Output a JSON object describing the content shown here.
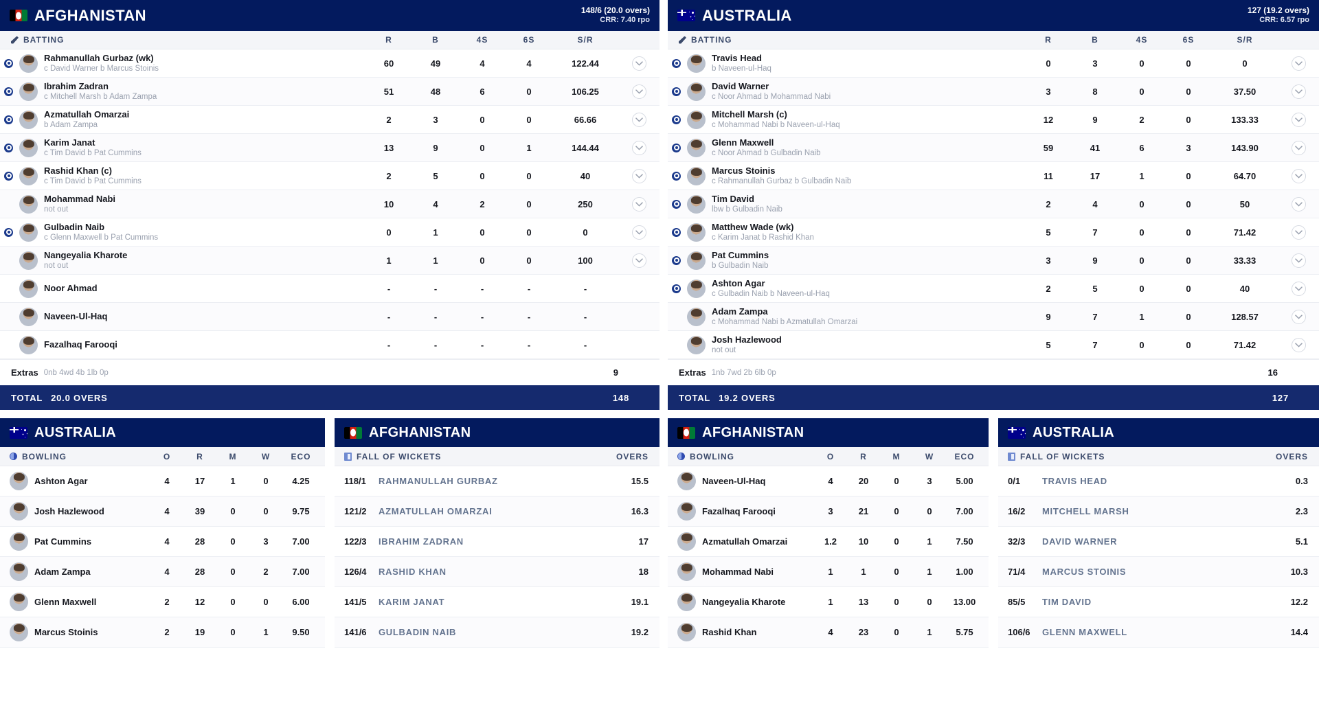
{
  "icons": {
    "bat": "bat-icon",
    "ball": "ball-icon",
    "pad": "pad-icon",
    "chevron": "chevron-down-icon"
  },
  "colors": {
    "header_navy": "#031a5e",
    "total_navy": "#152a6e",
    "col_head_bg": "#f4f5f8",
    "muted_text": "#9aa1af",
    "fow_name": "#64748f"
  },
  "innings": [
    {
      "id": "afghanistan-innings",
      "team": "AFGHANISTAN",
      "flag": "afghanistan-flag",
      "score": "148/6 (20.0 overs)",
      "crr": "CRR: 7.40 rpo",
      "section_label": "BATTING",
      "columns": [
        "R",
        "B",
        "4S",
        "6S",
        "S/R"
      ],
      "batters": [
        {
          "name": "Rahmanullah Gurbaz (wk)",
          "dismissal": "c David Warner b Marcus Stoinis",
          "r": "60",
          "b": "49",
          "fours": "4",
          "sixes": "4",
          "sr": "122.44",
          "out": true
        },
        {
          "name": "Ibrahim Zadran",
          "dismissal": "c Mitchell Marsh b Adam Zampa",
          "r": "51",
          "b": "48",
          "fours": "6",
          "sixes": "0",
          "sr": "106.25",
          "out": true
        },
        {
          "name": "Azmatullah Omarzai",
          "dismissal": "b Adam Zampa",
          "r": "2",
          "b": "3",
          "fours": "0",
          "sixes": "0",
          "sr": "66.66",
          "out": true
        },
        {
          "name": "Karim Janat",
          "dismissal": "c Tim David b Pat Cummins",
          "r": "13",
          "b": "9",
          "fours": "0",
          "sixes": "1",
          "sr": "144.44",
          "out": true
        },
        {
          "name": "Rashid Khan (c)",
          "dismissal": "c Tim David b Pat Cummins",
          "r": "2",
          "b": "5",
          "fours": "0",
          "sixes": "0",
          "sr": "40",
          "out": true
        },
        {
          "name": "Mohammad Nabi",
          "dismissal": "not out",
          "r": "10",
          "b": "4",
          "fours": "2",
          "sixes": "0",
          "sr": "250",
          "out": false
        },
        {
          "name": "Gulbadin Naib",
          "dismissal": "c Glenn Maxwell b Pat Cummins",
          "r": "0",
          "b": "1",
          "fours": "0",
          "sixes": "0",
          "sr": "0",
          "out": true
        },
        {
          "name": "Nangeyalia Kharote",
          "dismissal": "not out",
          "r": "1",
          "b": "1",
          "fours": "0",
          "sixes": "0",
          "sr": "100",
          "out": false
        },
        {
          "name": "Noor Ahmad",
          "dismissal": "",
          "r": "-",
          "b": "-",
          "fours": "-",
          "sixes": "-",
          "sr": "-",
          "out": false
        },
        {
          "name": "Naveen-Ul-Haq",
          "dismissal": "",
          "r": "-",
          "b": "-",
          "fours": "-",
          "sixes": "-",
          "sr": "-",
          "out": false
        },
        {
          "name": "Fazalhaq Farooqi",
          "dismissal": "",
          "r": "-",
          "b": "-",
          "fours": "-",
          "sixes": "-",
          "sr": "-",
          "out": false
        }
      ],
      "extras": {
        "label": "Extras",
        "detail": "0nb 4wd 4b 1lb 0p",
        "value": "9"
      },
      "total": {
        "label": "TOTAL",
        "overs": "20.0 OVERS",
        "value": "148"
      }
    },
    {
      "id": "australia-innings",
      "team": "AUSTRALIA",
      "flag": "australia-flag",
      "score": "127 (19.2 overs)",
      "crr": "CRR: 6.57 rpo",
      "section_label": "BATTING",
      "columns": [
        "R",
        "B",
        "4S",
        "6S",
        "S/R"
      ],
      "batters": [
        {
          "name": "Travis Head",
          "dismissal": "b Naveen-ul-Haq",
          "r": "0",
          "b": "3",
          "fours": "0",
          "sixes": "0",
          "sr": "0",
          "out": true
        },
        {
          "name": "David Warner",
          "dismissal": "c Noor Ahmad b Mohammad Nabi",
          "r": "3",
          "b": "8",
          "fours": "0",
          "sixes": "0",
          "sr": "37.50",
          "out": true
        },
        {
          "name": "Mitchell Marsh (c)",
          "dismissal": "c Mohammad Nabi b Naveen-ul-Haq",
          "r": "12",
          "b": "9",
          "fours": "2",
          "sixes": "0",
          "sr": "133.33",
          "out": true
        },
        {
          "name": "Glenn Maxwell",
          "dismissal": "c Noor Ahmad b Gulbadin Naib",
          "r": "59",
          "b": "41",
          "fours": "6",
          "sixes": "3",
          "sr": "143.90",
          "out": true
        },
        {
          "name": "Marcus Stoinis",
          "dismissal": "c Rahmanullah Gurbaz b Gulbadin Naib",
          "r": "11",
          "b": "17",
          "fours": "1",
          "sixes": "0",
          "sr": "64.70",
          "out": true
        },
        {
          "name": "Tim David",
          "dismissal": "lbw b Gulbadin Naib",
          "r": "2",
          "b": "4",
          "fours": "0",
          "sixes": "0",
          "sr": "50",
          "out": true
        },
        {
          "name": "Matthew Wade (wk)",
          "dismissal": "c Karim Janat b Rashid Khan",
          "r": "5",
          "b": "7",
          "fours": "0",
          "sixes": "0",
          "sr": "71.42",
          "out": true
        },
        {
          "name": "Pat Cummins",
          "dismissal": "b Gulbadin Naib",
          "r": "3",
          "b": "9",
          "fours": "0",
          "sixes": "0",
          "sr": "33.33",
          "out": true
        },
        {
          "name": "Ashton Agar",
          "dismissal": "c Gulbadin Naib b Naveen-ul-Haq",
          "r": "2",
          "b": "5",
          "fours": "0",
          "sixes": "0",
          "sr": "40",
          "out": true
        },
        {
          "name": "Adam Zampa",
          "dismissal": "c Mohammad Nabi b Azmatullah Omarzai",
          "r": "9",
          "b": "7",
          "fours": "1",
          "sixes": "0",
          "sr": "128.57",
          "out": false
        },
        {
          "name": "Josh Hazlewood",
          "dismissal": "not out",
          "r": "5",
          "b": "7",
          "fours": "0",
          "sixes": "0",
          "sr": "71.42",
          "out": false
        }
      ],
      "extras": {
        "label": "Extras",
        "detail": "1nb 7wd 2b 6lb 0p",
        "value": "16"
      },
      "total": {
        "label": "TOTAL",
        "overs": "19.2 OVERS",
        "value": "127"
      }
    }
  ],
  "bowling_panels": [
    {
      "id": "australia-bowling",
      "team": "AUSTRALIA",
      "flag": "australia-flag",
      "section_label": "BOWLING",
      "columns": [
        "O",
        "R",
        "M",
        "W",
        "ECO"
      ],
      "rows": [
        {
          "name": "Ashton Agar",
          "o": "4",
          "r": "17",
          "m": "1",
          "w": "0",
          "eco": "4.25"
        },
        {
          "name": "Josh Hazlewood",
          "o": "4",
          "r": "39",
          "m": "0",
          "w": "0",
          "eco": "9.75"
        },
        {
          "name": "Pat Cummins",
          "o": "4",
          "r": "28",
          "m": "0",
          "w": "3",
          "eco": "7.00"
        },
        {
          "name": "Adam Zampa",
          "o": "4",
          "r": "28",
          "m": "0",
          "w": "2",
          "eco": "7.00"
        },
        {
          "name": "Glenn Maxwell",
          "o": "2",
          "r": "12",
          "m": "0",
          "w": "0",
          "eco": "6.00"
        },
        {
          "name": "Marcus Stoinis",
          "o": "2",
          "r": "19",
          "m": "0",
          "w": "1",
          "eco": "9.50"
        }
      ]
    },
    {
      "id": "afghanistan-bowling",
      "team": "AFGHANISTAN",
      "flag": "afghanistan-flag",
      "section_label": "BOWLING",
      "columns": [
        "O",
        "R",
        "M",
        "W",
        "ECO"
      ],
      "rows": [
        {
          "name": "Naveen-Ul-Haq",
          "o": "4",
          "r": "20",
          "m": "0",
          "w": "3",
          "eco": "5.00"
        },
        {
          "name": "Fazalhaq Farooqi",
          "o": "3",
          "r": "21",
          "m": "0",
          "w": "0",
          "eco": "7.00"
        },
        {
          "name": "Azmatullah Omarzai",
          "o": "1.2",
          "r": "10",
          "m": "0",
          "w": "1",
          "eco": "7.50"
        },
        {
          "name": "Mohammad Nabi",
          "o": "1",
          "r": "1",
          "m": "0",
          "w": "1",
          "eco": "1.00"
        },
        {
          "name": "Nangeyalia Kharote",
          "o": "1",
          "r": "13",
          "m": "0",
          "w": "0",
          "eco": "13.00"
        },
        {
          "name": "Rashid Khan",
          "o": "4",
          "r": "23",
          "m": "0",
          "w": "1",
          "eco": "5.75"
        }
      ]
    }
  ],
  "fow_panels": [
    {
      "id": "afghanistan-fow",
      "team": "AFGHANISTAN",
      "flag": "afghanistan-flag",
      "section_label": "FALL OF WICKETS",
      "overs_label": "OVERS",
      "rows": [
        {
          "score": "118/1",
          "name": "RAHMANULLAH GURBAZ",
          "over": "15.5"
        },
        {
          "score": "121/2",
          "name": "AZMATULLAH OMARZAI",
          "over": "16.3"
        },
        {
          "score": "122/3",
          "name": "IBRAHIM ZADRAN",
          "over": "17"
        },
        {
          "score": "126/4",
          "name": "RASHID KHAN",
          "over": "18"
        },
        {
          "score": "141/5",
          "name": "KARIM JANAT",
          "over": "19.1"
        },
        {
          "score": "141/6",
          "name": "GULBADIN NAIB",
          "over": "19.2"
        }
      ]
    },
    {
      "id": "australia-fow",
      "team": "AUSTRALIA",
      "flag": "australia-flag",
      "section_label": "FALL OF WICKETS",
      "overs_label": "OVERS",
      "rows": [
        {
          "score": "0/1",
          "name": "TRAVIS HEAD",
          "over": "0.3"
        },
        {
          "score": "16/2",
          "name": "MITCHELL MARSH",
          "over": "2.3"
        },
        {
          "score": "32/3",
          "name": "DAVID WARNER",
          "over": "5.1"
        },
        {
          "score": "71/4",
          "name": "MARCUS STOINIS",
          "over": "10.3"
        },
        {
          "score": "85/5",
          "name": "TIM DAVID",
          "over": "12.2"
        },
        {
          "score": "106/6",
          "name": "GLENN MAXWELL",
          "over": "14.4"
        }
      ]
    }
  ]
}
